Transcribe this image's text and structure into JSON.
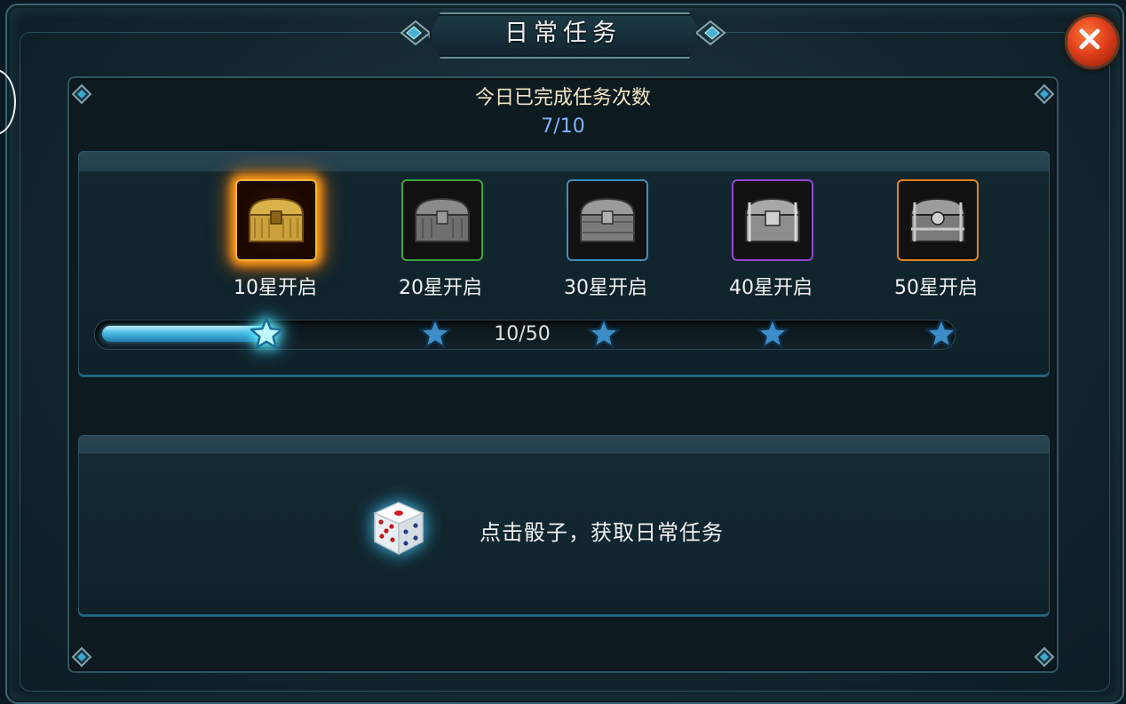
{
  "window": {
    "title": "日常任务"
  },
  "progress_summary": {
    "label": "今日已完成任务次数",
    "value": "7/10"
  },
  "chests": [
    {
      "label": "10星开启",
      "state": "available",
      "color": "#ffb43a"
    },
    {
      "label": "20星开启",
      "state": "locked",
      "color": "#3fa040"
    },
    {
      "label": "30星开启",
      "state": "locked",
      "color": "#3c90c0"
    },
    {
      "label": "40星开启",
      "state": "locked",
      "color": "#9048d0"
    },
    {
      "label": "50星开启",
      "state": "locked",
      "color": "#e08420"
    }
  ],
  "star_progress": {
    "text": "10/50",
    "current": 10,
    "max": 50
  },
  "dice": {
    "hint": "点击骰子，获取日常任务",
    "icon": "dice-icon"
  },
  "close": {
    "icon": "close-icon"
  }
}
